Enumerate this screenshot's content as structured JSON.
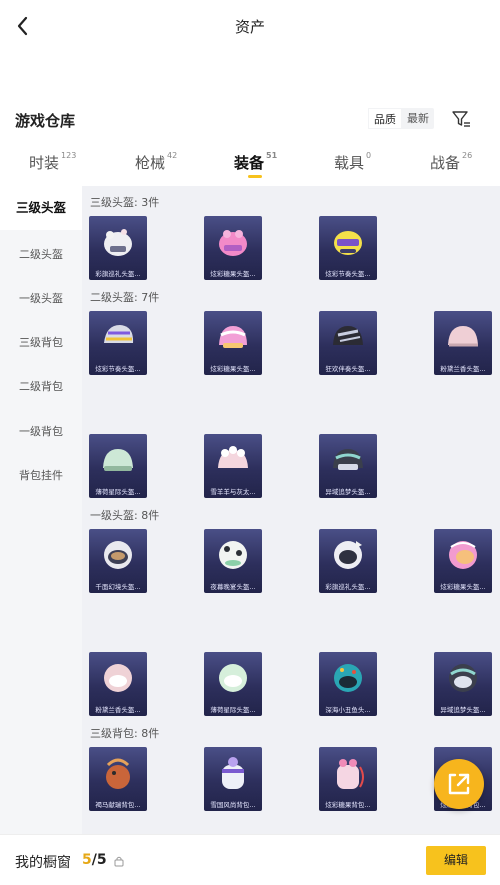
{
  "header": {
    "title": "资产"
  },
  "warehouse": {
    "title": "游戏仓库",
    "sort_quality": "品质",
    "sort_newest": "最新"
  },
  "tabs": [
    {
      "label": "时装",
      "count": "123"
    },
    {
      "label": "枪械",
      "count": "42"
    },
    {
      "label": "装备",
      "count": "51"
    },
    {
      "label": "载具",
      "count": "0"
    },
    {
      "label": "战备",
      "count": "26"
    }
  ],
  "sidebar": [
    {
      "label": "三级头盔"
    },
    {
      "label": "二级头盔"
    },
    {
      "label": "一级头盔"
    },
    {
      "label": "三级背包"
    },
    {
      "label": "二级背包"
    },
    {
      "label": "一级背包"
    },
    {
      "label": "背包挂件"
    }
  ],
  "sections": [
    {
      "title": "三级头盔: 3件",
      "items": [
        {
          "name": "彩旗巡礼头盔..."
        },
        {
          "name": "炫彩糖果头盔..."
        },
        {
          "name": "炫彩节奏头盔..."
        }
      ]
    },
    {
      "title": "二级头盔: 7件",
      "items": [
        {
          "name": "炫彩节奏头盔..."
        },
        {
          "name": "炫彩糖果头盔..."
        },
        {
          "name": "狂欢伴奏头盔..."
        },
        {
          "name": "粉黛兰香头盔..."
        },
        {
          "name": "薄荷星际头盔..."
        },
        {
          "name": "雪羊羊与灰太..."
        },
        {
          "name": "异域追梦头盔..."
        }
      ]
    },
    {
      "title": "一级头盔: 8件",
      "items": [
        {
          "name": "千面幻境头盔..."
        },
        {
          "name": "夜幕晚宴头盔..."
        },
        {
          "name": "彩旗巡礼头盔..."
        },
        {
          "name": "炫彩糖果头盔..."
        },
        {
          "name": "粉黛兰香头盔..."
        },
        {
          "name": "薄荷星际头盔..."
        },
        {
          "name": "深海小丑鱼头..."
        },
        {
          "name": "异域追梦头盔..."
        }
      ]
    },
    {
      "title": "三级背包: 8件",
      "items": [
        {
          "name": "褐马献瑞背包..."
        },
        {
          "name": "雪国风尚背包..."
        },
        {
          "name": "炫彩糖果背包..."
        },
        {
          "name": "炫彩节奏背包..."
        }
      ]
    }
  ],
  "bottom": {
    "label": "我的橱窗",
    "current": "5",
    "total": "/5",
    "edit": "编辑"
  },
  "colors": {
    "accent": "#f7c21d",
    "card_bg": "#2d2f5c",
    "fab": "#f7b51d"
  }
}
